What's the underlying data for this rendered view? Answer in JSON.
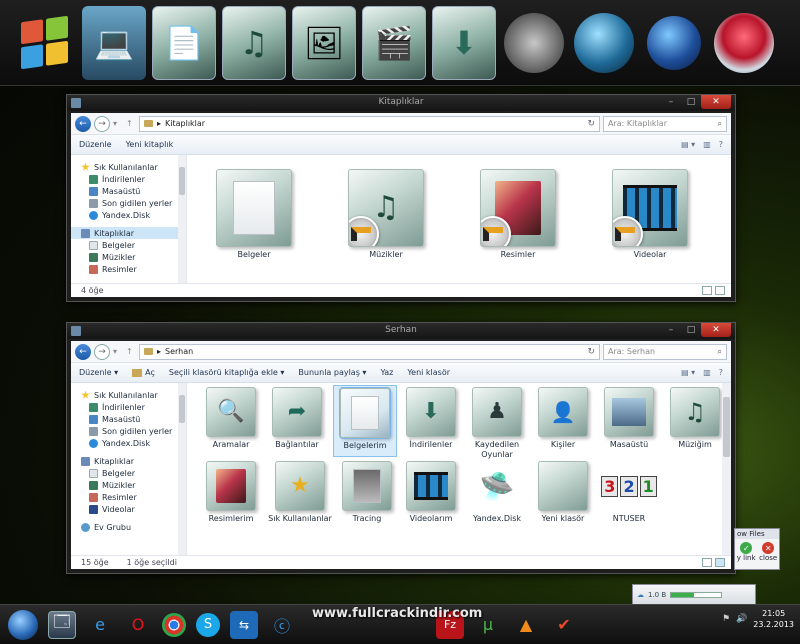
{
  "window1": {
    "title": "Kitaplıklar",
    "address": "Kitaplıklar",
    "search_placeholder": "Ara: Kitaplıklar",
    "commands": {
      "organize": "Düzenle",
      "new_library": "Yeni kitaplık"
    },
    "nav": {
      "favorites": "Sık Kullanılanlar",
      "downloads": "İndirilenler",
      "desktop": "Masaüstü",
      "recent": "Son gidilen yerler",
      "yandex": "Yandex.Disk",
      "libraries": "Kitaplıklar",
      "documents": "Belgeler",
      "music": "Müzikler",
      "pictures": "Resimler"
    },
    "items": [
      "Belgeler",
      "Müzikler",
      "Resimler",
      "Videolar"
    ],
    "status": "4 öğe"
  },
  "window2": {
    "title": "Serhan",
    "address": "Serhan",
    "search_placeholder": "Ara: Serhan",
    "commands": {
      "organize": "Düzenle",
      "open": "Aç",
      "include": "Seçili klasörü kitaplığa ekle",
      "share": "Bununla paylaş",
      "burn": "Yaz",
      "new_folder": "Yeni klasör"
    },
    "nav": {
      "favorites": "Sık Kullanılanlar",
      "downloads": "İndirilenler",
      "desktop": "Masaüstü",
      "recent": "Son gidilen yerler",
      "yandex": "Yandex.Disk",
      "libraries": "Kitaplıklar",
      "documents": "Belgeler",
      "music": "Müzikler",
      "pictures": "Resimler",
      "videos": "Videolar",
      "homegroup": "Ev Grubu"
    },
    "items_row1": [
      "Aramalar",
      "Bağlantılar",
      "Belgelerim",
      "İndirilenler",
      "Kaydedilen Oyunlar",
      "Kişiler",
      "Masaüstü",
      "Müziğim"
    ],
    "items_row2": [
      "Resimlerim",
      "Sık Kullanılanlar",
      "Tracing",
      "Videolarım",
      "Yandex.Disk",
      "Yeni klasör",
      "NTUSER"
    ],
    "status_count": "15 öğe",
    "status_selected": "1 öğe seçildi"
  },
  "taskbar": {
    "watermark": "www.fullcrackindir.com",
    "time": "21:05",
    "date": "23.2.2013"
  },
  "popup": {
    "title": "ow Files",
    "link": "y link",
    "close": "close"
  },
  "gadget": {
    "value": "1.0 B",
    "progress_pct": 45
  },
  "colors": {
    "accent": "#1c5aa8",
    "close": "#c42b1c",
    "selection": "#cde6f7"
  }
}
